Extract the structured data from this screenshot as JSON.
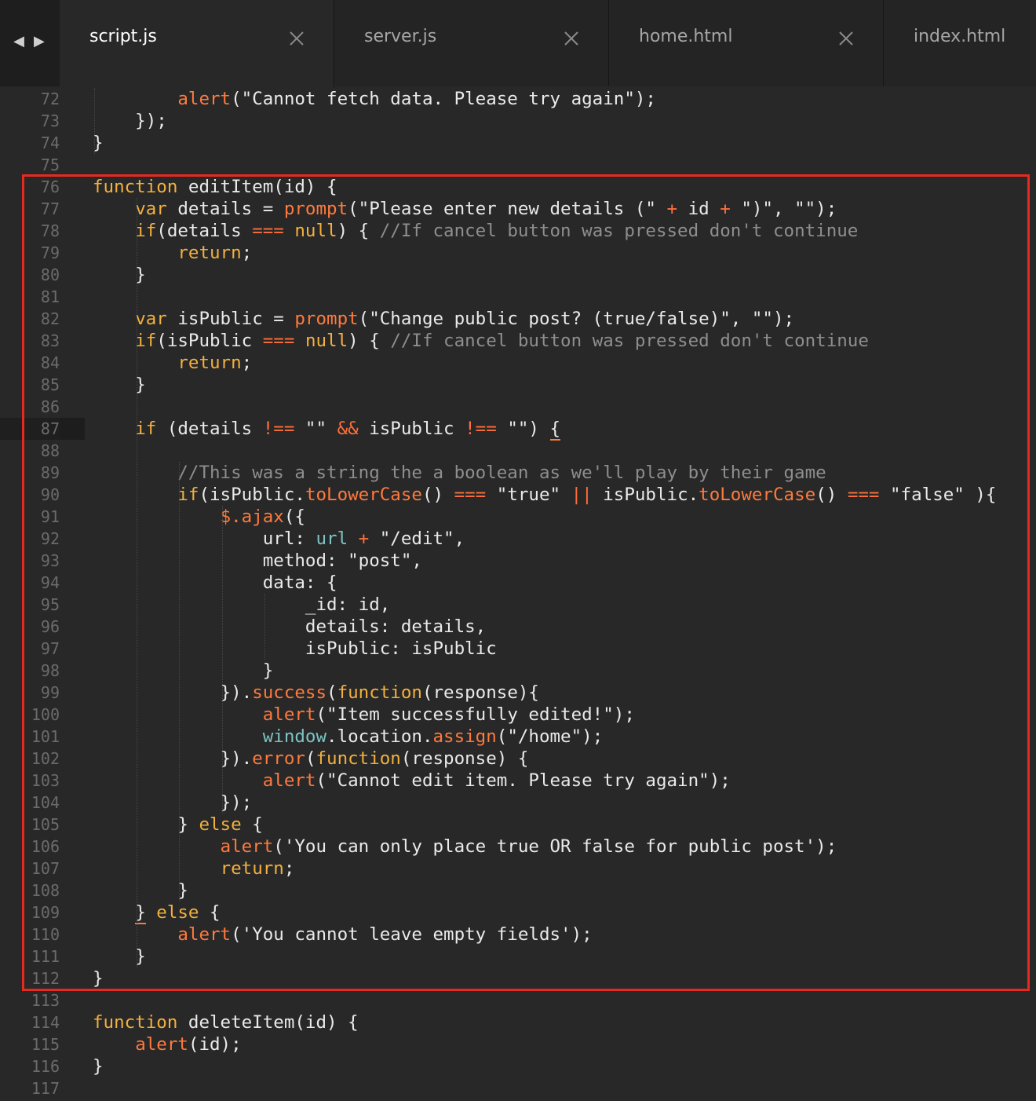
{
  "tabs": [
    {
      "label": "script.js",
      "active": true
    },
    {
      "label": "server.js",
      "active": false
    },
    {
      "label": "home.html",
      "active": false
    },
    {
      "label": "index.html",
      "active": false
    }
  ],
  "nav": {
    "back": "◀",
    "forward": "▶"
  },
  "lines": [
    {
      "n": "72",
      "tokens": [
        [
          "plain",
          "        "
        ],
        [
          "fn",
          "alert"
        ],
        [
          "plain",
          "(\"Cannot fetch data. Please try again\");"
        ]
      ]
    },
    {
      "n": "73",
      "tokens": [
        [
          "plain",
          "    });"
        ]
      ]
    },
    {
      "n": "74",
      "tokens": [
        [
          "plain",
          "}"
        ]
      ]
    },
    {
      "n": "75",
      "tokens": []
    },
    {
      "n": "76",
      "tokens": [
        [
          "kw",
          "function"
        ],
        [
          "plain",
          " editItem(id) {"
        ]
      ]
    },
    {
      "n": "77",
      "tokens": [
        [
          "plain",
          "    "
        ],
        [
          "kw",
          "var"
        ],
        [
          "plain",
          " details = "
        ],
        [
          "fn",
          "prompt"
        ],
        [
          "plain",
          "(\"Please enter new details (\" "
        ],
        [
          "op",
          "+"
        ],
        [
          "plain",
          " id "
        ],
        [
          "op",
          "+"
        ],
        [
          "plain",
          " \")\", \"\");"
        ]
      ]
    },
    {
      "n": "78",
      "tokens": [
        [
          "plain",
          "    "
        ],
        [
          "kw",
          "if"
        ],
        [
          "plain",
          "(details "
        ],
        [
          "op",
          "==="
        ],
        [
          "plain",
          " "
        ],
        [
          "kw",
          "null"
        ],
        [
          "plain",
          ") { "
        ],
        [
          "cm",
          "//If cancel button was pressed don't continue"
        ]
      ]
    },
    {
      "n": "79",
      "tokens": [
        [
          "plain",
          "        "
        ],
        [
          "kw",
          "return"
        ],
        [
          "plain",
          ";"
        ]
      ]
    },
    {
      "n": "80",
      "tokens": [
        [
          "plain",
          "    }"
        ]
      ]
    },
    {
      "n": "81",
      "tokens": []
    },
    {
      "n": "82",
      "tokens": [
        [
          "plain",
          "    "
        ],
        [
          "kw",
          "var"
        ],
        [
          "plain",
          " isPublic = "
        ],
        [
          "fn",
          "prompt"
        ],
        [
          "plain",
          "(\"Change public post? (true/false)\", \"\");"
        ]
      ]
    },
    {
      "n": "83",
      "tokens": [
        [
          "plain",
          "    "
        ],
        [
          "kw",
          "if"
        ],
        [
          "plain",
          "(isPublic "
        ],
        [
          "op",
          "==="
        ],
        [
          "plain",
          " "
        ],
        [
          "kw",
          "null"
        ],
        [
          "plain",
          ") { "
        ],
        [
          "cm",
          "//If cancel button was pressed don't continue"
        ]
      ]
    },
    {
      "n": "84",
      "tokens": [
        [
          "plain",
          "        "
        ],
        [
          "kw",
          "return"
        ],
        [
          "plain",
          ";"
        ]
      ]
    },
    {
      "n": "85",
      "tokens": [
        [
          "plain",
          "    }"
        ]
      ]
    },
    {
      "n": "86",
      "tokens": []
    },
    {
      "n": "87",
      "current": true,
      "tokens": [
        [
          "plain",
          "    "
        ],
        [
          "kw",
          "if"
        ],
        [
          "plain",
          " (details "
        ],
        [
          "op",
          "!=="
        ],
        [
          "plain",
          " \"\" "
        ],
        [
          "op",
          "&&"
        ],
        [
          "plain",
          " isPublic "
        ],
        [
          "op",
          "!=="
        ],
        [
          "plain",
          " \"\") "
        ],
        [
          "caret",
          "{"
        ]
      ]
    },
    {
      "n": "88",
      "tokens": []
    },
    {
      "n": "89",
      "tokens": [
        [
          "plain",
          "        "
        ],
        [
          "cm",
          "//This was a string the a boolean as we'll play by their game"
        ]
      ]
    },
    {
      "n": "90",
      "tokens": [
        [
          "plain",
          "        "
        ],
        [
          "kw",
          "if"
        ],
        [
          "plain",
          "(isPublic."
        ],
        [
          "fn",
          "toLowerCase"
        ],
        [
          "plain",
          "() "
        ],
        [
          "op",
          "==="
        ],
        [
          "plain",
          " \"true\" "
        ],
        [
          "op",
          "||"
        ],
        [
          "plain",
          " isPublic."
        ],
        [
          "fn",
          "toLowerCase"
        ],
        [
          "plain",
          "() "
        ],
        [
          "op",
          "==="
        ],
        [
          "plain",
          " \"false\" ){"
        ]
      ]
    },
    {
      "n": "91",
      "tokens": [
        [
          "plain",
          "            "
        ],
        [
          "fn",
          "$.ajax"
        ],
        [
          "plain",
          "({"
        ]
      ]
    },
    {
      "n": "92",
      "tokens": [
        [
          "plain",
          "                url: "
        ],
        [
          "var",
          "url"
        ],
        [
          "plain",
          " "
        ],
        [
          "op",
          "+"
        ],
        [
          "plain",
          " \"/edit\","
        ]
      ]
    },
    {
      "n": "93",
      "tokens": [
        [
          "plain",
          "                method: \"post\","
        ]
      ]
    },
    {
      "n": "94",
      "tokens": [
        [
          "plain",
          "                data: {"
        ]
      ]
    },
    {
      "n": "95",
      "tokens": [
        [
          "plain",
          "                    _id: id,"
        ]
      ]
    },
    {
      "n": "96",
      "tokens": [
        [
          "plain",
          "                    details: details,"
        ]
      ]
    },
    {
      "n": "97",
      "tokens": [
        [
          "plain",
          "                    isPublic: isPublic"
        ]
      ]
    },
    {
      "n": "98",
      "tokens": [
        [
          "plain",
          "                }"
        ]
      ]
    },
    {
      "n": "99",
      "tokens": [
        [
          "plain",
          "            })."
        ],
        [
          "fn",
          "success"
        ],
        [
          "plain",
          "("
        ],
        [
          "kw",
          "function"
        ],
        [
          "plain",
          "(response){"
        ]
      ]
    },
    {
      "n": "100",
      "tokens": [
        [
          "plain",
          "                "
        ],
        [
          "fn",
          "alert"
        ],
        [
          "plain",
          "(\"Item successfully edited!\");"
        ]
      ]
    },
    {
      "n": "101",
      "tokens": [
        [
          "plain",
          "                "
        ],
        [
          "var",
          "window"
        ],
        [
          "plain",
          ".location."
        ],
        [
          "fn",
          "assign"
        ],
        [
          "plain",
          "(\"/home\");"
        ]
      ]
    },
    {
      "n": "102",
      "tokens": [
        [
          "plain",
          "            })."
        ],
        [
          "fn",
          "error"
        ],
        [
          "plain",
          "("
        ],
        [
          "kw",
          "function"
        ],
        [
          "plain",
          "(response) {"
        ]
      ]
    },
    {
      "n": "103",
      "tokens": [
        [
          "plain",
          "                "
        ],
        [
          "fn",
          "alert"
        ],
        [
          "plain",
          "(\"Cannot edit item. Please try again\");"
        ]
      ]
    },
    {
      "n": "104",
      "tokens": [
        [
          "plain",
          "            });"
        ]
      ]
    },
    {
      "n": "105",
      "tokens": [
        [
          "plain",
          "        } "
        ],
        [
          "kw",
          "else"
        ],
        [
          "plain",
          " {"
        ]
      ]
    },
    {
      "n": "106",
      "tokens": [
        [
          "plain",
          "            "
        ],
        [
          "fn",
          "alert"
        ],
        [
          "plain",
          "('You can only place true OR false for public post');"
        ]
      ]
    },
    {
      "n": "107",
      "tokens": [
        [
          "plain",
          "            "
        ],
        [
          "kw",
          "return"
        ],
        [
          "plain",
          ";"
        ]
      ]
    },
    {
      "n": "108",
      "tokens": [
        [
          "plain",
          "        }"
        ]
      ]
    },
    {
      "n": "109",
      "tokens": [
        [
          "plain",
          "    "
        ],
        [
          "caret",
          "}"
        ],
        [
          "plain",
          " "
        ],
        [
          "kw",
          "else"
        ],
        [
          "plain",
          " {"
        ]
      ]
    },
    {
      "n": "110",
      "tokens": [
        [
          "plain",
          "        "
        ],
        [
          "fn",
          "alert"
        ],
        [
          "plain",
          "('You cannot leave empty fields');"
        ]
      ]
    },
    {
      "n": "111",
      "tokens": [
        [
          "plain",
          "    }"
        ]
      ]
    },
    {
      "n": "112",
      "tokens": [
        [
          "plain",
          "}"
        ]
      ]
    },
    {
      "n": "113",
      "tokens": []
    },
    {
      "n": "114",
      "tokens": [
        [
          "kw",
          "function"
        ],
        [
          "plain",
          " deleteItem(id) {"
        ]
      ]
    },
    {
      "n": "115",
      "tokens": [
        [
          "plain",
          "    "
        ],
        [
          "fn",
          "alert"
        ],
        [
          "plain",
          "(id);"
        ]
      ]
    },
    {
      "n": "116",
      "tokens": [
        [
          "plain",
          "}"
        ]
      ]
    },
    {
      "n": "117",
      "tokens": []
    }
  ]
}
